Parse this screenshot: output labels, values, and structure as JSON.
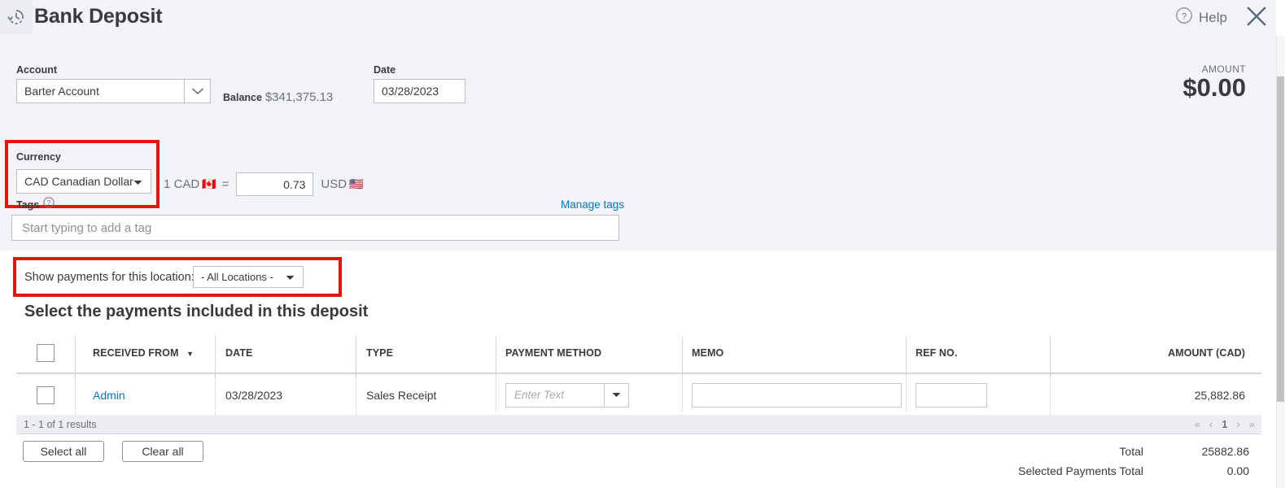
{
  "header": {
    "icon": "history-clock-icon",
    "title": "Bank Deposit",
    "help_label": "Help",
    "help_icon": "question-circle-icon",
    "close_icon": "close-icon"
  },
  "form": {
    "account_label": "Account",
    "account_value": "Barter Account",
    "balance_label": "Balance",
    "balance_value": "$341,375.13",
    "date_label": "Date",
    "date_value": "03/28/2023",
    "amount_label": "AMOUNT",
    "amount_value": "$0.00"
  },
  "currency": {
    "label": "Currency",
    "value": "CAD Canadian Dollar",
    "rate_prefix": "1 CAD",
    "from_flag": "🇨🇦",
    "equals": "=",
    "rate_value": "0.73",
    "to_code": "USD",
    "to_flag": "🇺🇸"
  },
  "tags": {
    "label": "Tags",
    "help_icon": "question-circle-icon",
    "manage_link": "Manage tags",
    "placeholder": "Start typing to add a tag"
  },
  "location": {
    "label": "Show payments for this location:",
    "value": "- All Locations -"
  },
  "section": {
    "heading": "Select the payments included in this deposit"
  },
  "table": {
    "columns": [
      "RECEIVED FROM",
      "DATE",
      "TYPE",
      "PAYMENT METHOD",
      "MEMO",
      "REF NO.",
      "AMOUNT (CAD)"
    ],
    "rows": [
      {
        "received_from": "Admin",
        "date": "03/28/2023",
        "type": "Sales Receipt",
        "payment_method_placeholder": "Enter Text",
        "memo": "",
        "ref_no": "",
        "amount": "25,882.86"
      }
    ],
    "results_text": "1 - 1 of 1 results",
    "pager": {
      "first": "«",
      "prev": "‹",
      "current": "1",
      "next": "›",
      "last": "»"
    }
  },
  "actions": {
    "select_all": "Select all",
    "clear_all": "Clear all"
  },
  "totals": {
    "total_label": "Total",
    "total_value": "25882.86",
    "selected_label": "Selected Payments Total",
    "selected_value": "0.00"
  },
  "colors": {
    "highlight": "#e8140c",
    "link": "#0077c5",
    "band": "#f2f3f6"
  }
}
